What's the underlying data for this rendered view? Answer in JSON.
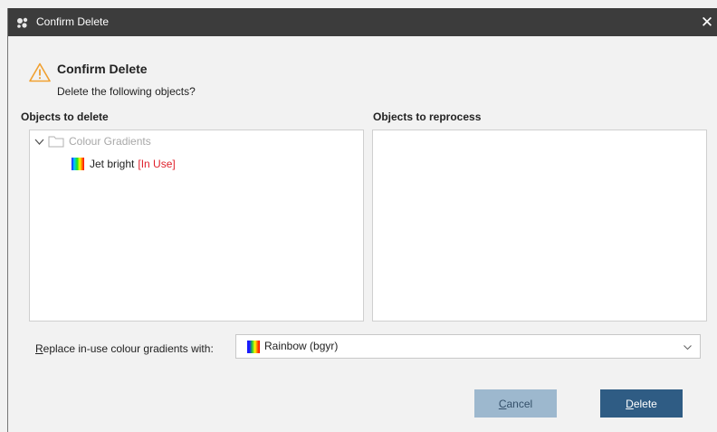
{
  "window": {
    "title": "Confirm Delete",
    "close_glyph": "✕"
  },
  "message": {
    "heading": "Confirm Delete",
    "subheading": "Delete the following objects?"
  },
  "sections": {
    "to_delete_label": "Objects to delete",
    "to_reprocess_label": "Objects to reprocess"
  },
  "tree": {
    "folder_label": "Colour Gradients",
    "items": [
      {
        "label": "Jet bright",
        "status": "[In Use]"
      }
    ]
  },
  "replace": {
    "label_prefix": "R",
    "label_rest": "eplace in-use colour gradients with:",
    "selected": "Rainbow (bgyr)"
  },
  "buttons": {
    "cancel_first": "C",
    "cancel_rest": "ancel",
    "delete_first": "D",
    "delete_rest": "elete"
  },
  "colors": {
    "titlebar": "#3c3c3c",
    "primary_button": "#2f5c84",
    "disabled_button": "#9db8ce",
    "in_use": "#e0202b",
    "warning": "#f0a030"
  },
  "icons": {
    "app": "app-logo-icon",
    "warning": "warning-triangle-icon",
    "expand": "chevron-down-icon",
    "folder": "folder-icon",
    "gradient": "colour-gradient-icon",
    "dropdown": "chevron-down-icon"
  }
}
